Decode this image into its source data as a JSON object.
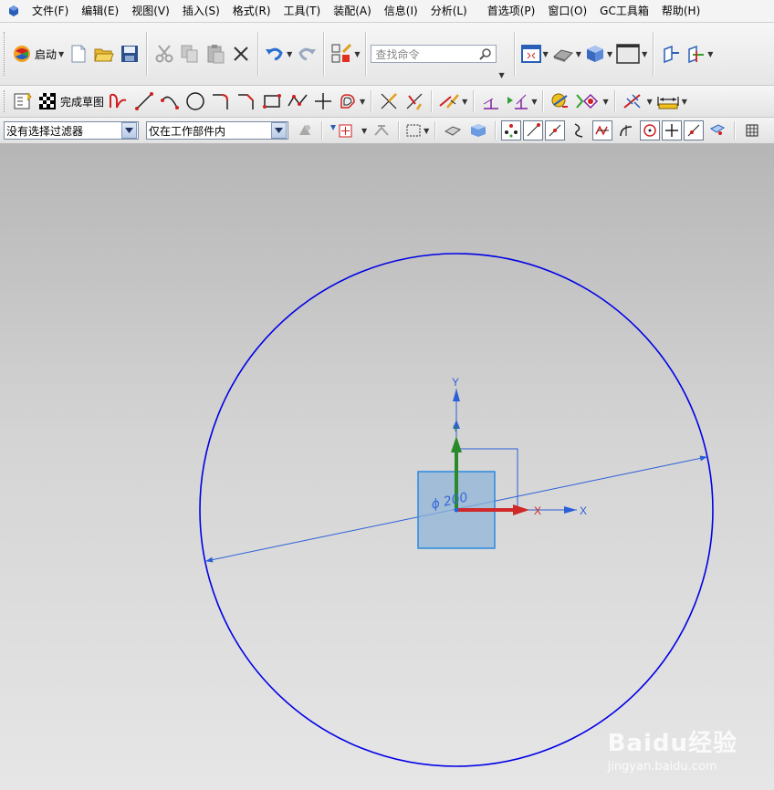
{
  "menu": [
    "文件(F)",
    "编辑(E)",
    "视图(V)",
    "插入(S)",
    "格式(R)",
    "工具(T)",
    "装配(A)",
    "信息(I)",
    "分析(L)",
    "首选项(P)",
    "窗口(O)",
    "GC工具箱",
    "帮助(H)"
  ],
  "toolbar": {
    "start_label": "启动",
    "search_placeholder": "查找命令",
    "finish_sketch_label": "完成草图"
  },
  "filter_bar": {
    "selection_filter": "没有选择过滤器",
    "scope": "仅在工作部件内"
  },
  "viewport": {
    "dimension_text": "ϕ 200",
    "axis_y": "Y",
    "axis_x": "X",
    "curve_color": "#0000e6"
  },
  "watermark": {
    "main": "Baidu经验",
    "sub": "jingyan.baidu.com"
  }
}
